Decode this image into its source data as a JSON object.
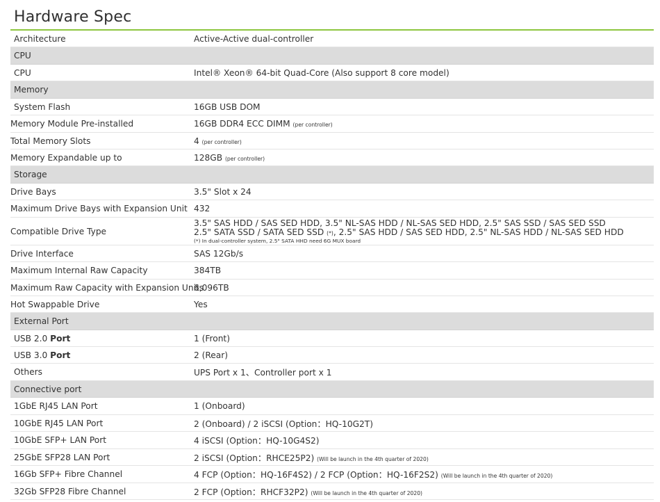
{
  "page": {
    "title": "Hardware Spec"
  },
  "rows": {
    "architecture": {
      "label": "Architecture",
      "value": "Active-Active dual-controller"
    },
    "cpu_section": "CPU",
    "cpu": {
      "label": "CPU",
      "value": "Intel® Xeon®  64-bit Quad-Core (Also support 8 core model)"
    },
    "memory_section": "Memory",
    "system_flash": {
      "label": "System Flash",
      "value": "16GB USB DOM"
    },
    "memory_module": {
      "label": "Memory Module Pre-installed",
      "value": "16GB DDR4 ECC DIMM",
      "note": "(per controller)"
    },
    "memory_slots": {
      "label": "Total Memory Slots",
      "value": "4",
      "note": "(per controller)"
    },
    "memory_expandable": {
      "label": "Memory Expandable up to",
      "value": "128GB",
      "note": "(per controller)"
    },
    "storage_section": "Storage",
    "drive_bays": {
      "label": "Drive Bays",
      "value": "3.5\" Slot x 24"
    },
    "max_drive_bays": {
      "label": "Maximum Drive Bays with Expansion Unit",
      "value": "432"
    },
    "compatible_drive": {
      "label": "Compatible Drive Type",
      "line1": "3.5\" SAS HDD / SAS SED HDD, 3.5\" NL-SAS HDD / NL-SAS SED HDD, 2.5\" SAS SSD / SAS SED SSD",
      "line2a": "2.5\" SATA SSD / SATA SED SSD",
      "line2_mark": "(*)",
      "line2b": ", 2.5\" SAS HDD / SAS SED HDD, 2.5\" NL-SAS HDD / NL-SAS SED HDD",
      "note": "(*) In dual-controller system, 2.5\"  SATA HHD need 6G MUX board"
    },
    "drive_interface": {
      "label": "Drive Interface",
      "value": "SAS 12Gb/s"
    },
    "max_internal_raw": {
      "label": "Maximum Internal Raw Capacity",
      "value": "384TB"
    },
    "max_raw_expansion": {
      "label": "Maximum Raw Capacity with Expansion Units",
      "value": "6,096TB"
    },
    "hot_swappable": {
      "label": "Hot Swappable Drive",
      "value": "Yes"
    },
    "external_port_section": "External Port",
    "usb20": {
      "label_a": "USB 2.0 ",
      "label_b": "Port",
      "value": "1 (Front)"
    },
    "usb30": {
      "label_a": "USB 3.0 ",
      "label_b": "Port",
      "value": "2 (Rear)"
    },
    "others": {
      "label": "Others",
      "value": "UPS Port x 1、Controller port x 1"
    },
    "connective_section": "Connective port",
    "lan_1gbe": {
      "label": "1GbE RJ45 LAN Port",
      "value": "1 (Onboard)"
    },
    "lan_10gbe_rj45": {
      "label": "10GbE RJ45 LAN Port",
      "value": "2 (Onboard) / 2 iSCSI (Option：HQ-10G2T)"
    },
    "lan_10gbe_sfp": {
      "label": "10GbE SFP+ LAN Port",
      "value": "4 iSCSI (Option：HQ-10G4S2)"
    },
    "lan_25gbe": {
      "label": "25GbE SFP28 LAN Port",
      "value": "2 iSCSI (Option：RHCE25P2)",
      "note": "(Will be launch in the 4th quarter of 2020)"
    },
    "fc_16gb": {
      "label": "16Gb SFP+ Fibre Channel",
      "value": "4 FCP (Option：HQ-16F4S2) / 2 FCP (Option：HQ-16F2S2)",
      "note": "(Will be launch in the 4th quarter of 2020)"
    },
    "fc_32gb": {
      "label": "32Gb SFP28 Fibre Channel",
      "value": "2 FCP (Option：RHCF32P2)",
      "note": "(Will be launch in the 4th quarter of 2020)"
    }
  },
  "colors": {
    "accent": "#8dc63f",
    "section_bg": "#dcdcdc",
    "divider": "#e4e4e4"
  }
}
